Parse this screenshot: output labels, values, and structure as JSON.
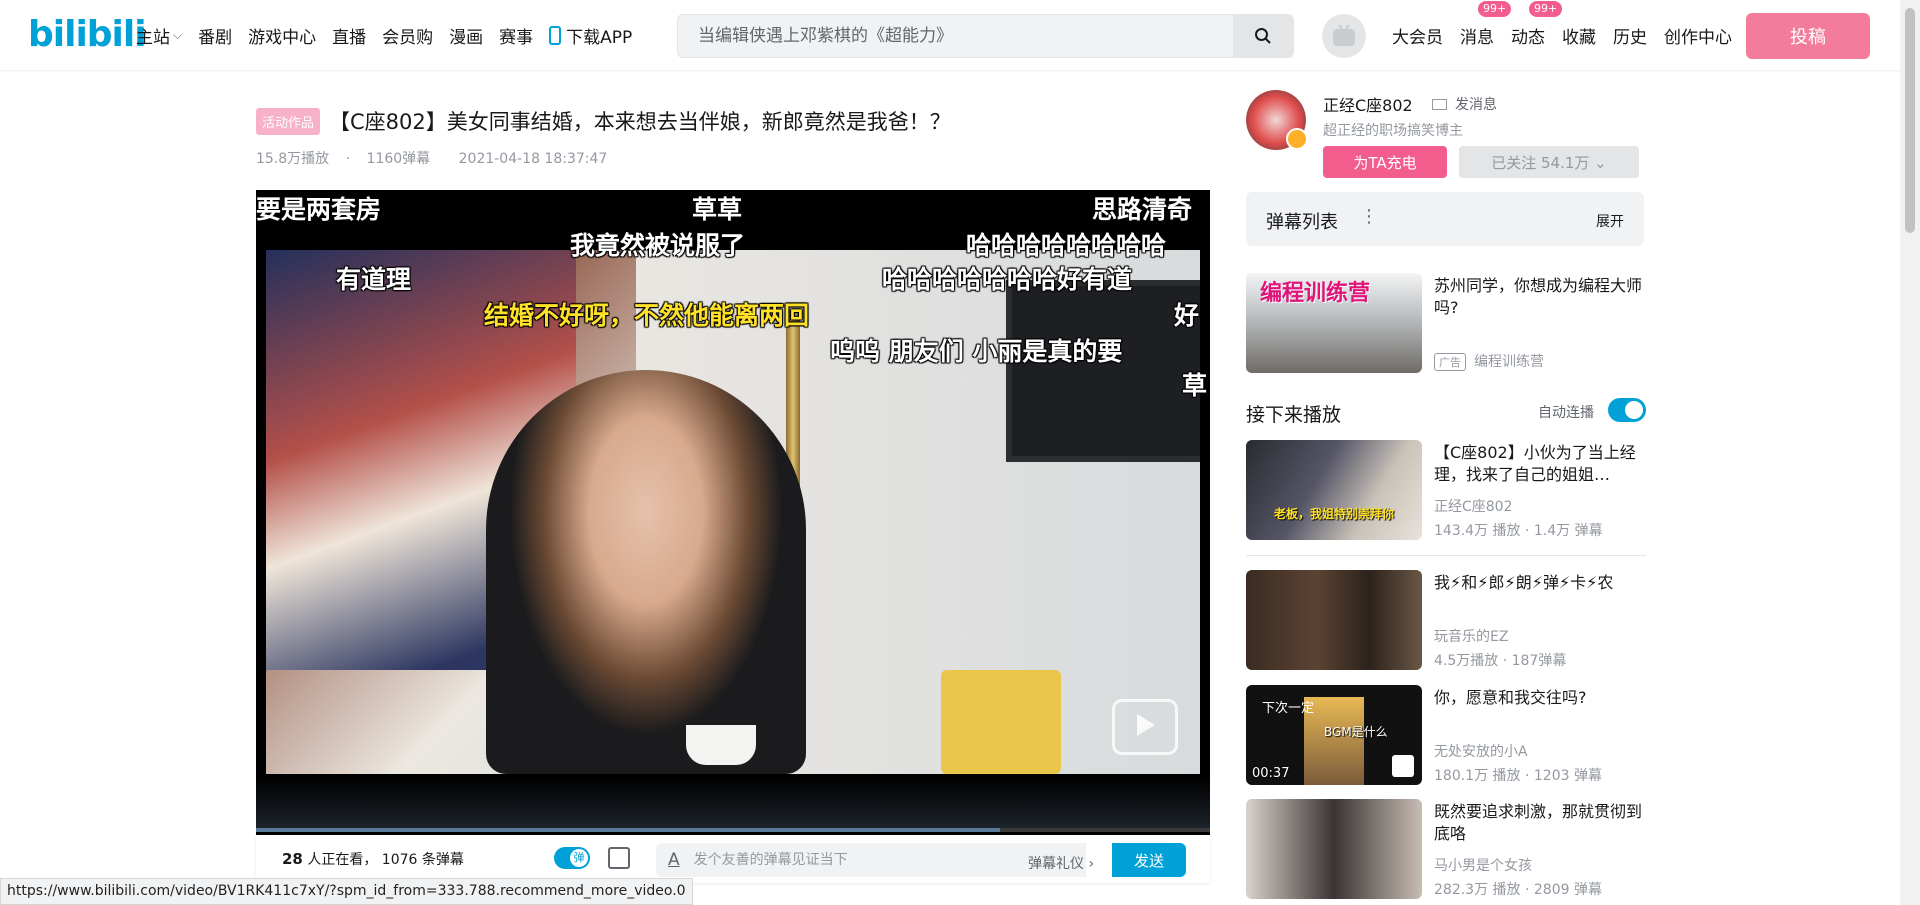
{
  "header": {
    "logo": "bilibili",
    "nav_left": [
      "主站",
      "番剧",
      "游戏中心",
      "直播",
      "会员购",
      "漫画",
      "赛事",
      "下载APP"
    ],
    "search_placeholder": "当编辑侠遇上邓紫棋的《超能力》",
    "nav_right": [
      {
        "label": "大会员",
        "badge": ""
      },
      {
        "label": "消息",
        "badge": "99+"
      },
      {
        "label": "动态",
        "badge": "99+"
      },
      {
        "label": "收藏",
        "badge": ""
      },
      {
        "label": "历史",
        "badge": ""
      },
      {
        "label": "创作中心",
        "badge": ""
      }
    ],
    "upload": "投稿"
  },
  "video": {
    "tag": "活动作品",
    "title": "【C座802】美女同事结婚，本来想去当伴娘，新郎竟然是我爸！？",
    "plays": "15.8万播放",
    "separator": "·",
    "danmaku_count": "1160弹幕",
    "date": "2021-04-18 18:37:47",
    "progress": 0.78
  },
  "danmaku_on_screen": [
    {
      "text": "要是两套房",
      "color": "#ffffff"
    },
    {
      "text": "草草",
      "color": "#ffffff"
    },
    {
      "text": "思路清奇",
      "color": "#ffffff"
    },
    {
      "text": "我竟然被说服了",
      "color": "#ffffff"
    },
    {
      "text": "哈哈哈哈哈哈哈哈",
      "color": "#ffffff"
    },
    {
      "text": "有道理",
      "color": "#ffffff"
    },
    {
      "text": "哈哈哈哈哈哈哈好有道",
      "color": "#ffffff"
    },
    {
      "text": "结婚不好呀，不然他能离两回",
      "color": "#ffe227"
    },
    {
      "text": "好",
      "color": "#ffffff"
    },
    {
      "text": "呜呜  朋友们  小丽是真的要",
      "color": "#ffffff"
    },
    {
      "text": "草",
      "color": "#ffffff"
    }
  ],
  "sendbar": {
    "viewers_num": "28",
    "viewers_text": "人正在看，",
    "dm_total": "1076 条弹幕",
    "input_placeholder": "发个友善的弹幕见证当下",
    "etiquette": "弹幕礼仪 ›",
    "send": "发送"
  },
  "status_url": "https://www.bilibili.com/video/BV1RK411c7xY/?spm_id_from=333.788.recommend_more_video.0",
  "up": {
    "name": "正经C座802",
    "message": "发消息",
    "desc": "超正经的职场搞笑博主",
    "charge": "为TA充电",
    "follow": "已关注 54.1万 ⌄"
  },
  "danmaku_list": {
    "label": "弹幕列表",
    "dots": "⋮",
    "expand": "展开"
  },
  "ad": {
    "thumb_text": "编程训练营",
    "title": "苏州同学，你想成为编程大师吗?",
    "tag": "广告",
    "author": "编程训练营"
  },
  "up_next": {
    "label": "接下来播放",
    "autoplay": "自动连播"
  },
  "recommendations": [
    {
      "title": "【C座802】小伙为了当上经理，找来了自己的姐姐…",
      "author": "正经C座802",
      "stats": "143.4万 播放 · 1.4万 弹幕",
      "thumb_caption": "老板，我姐特别崇拜你",
      "duration": ""
    },
    {
      "title": "我⚡和⚡郎⚡朗⚡弹⚡卡⚡农",
      "author": "玩音乐的EZ",
      "stats": "4.5万播放 · 187弹幕",
      "thumb_caption": "",
      "duration": ""
    },
    {
      "title": "你，愿意和我交往吗?",
      "author": "无处安放的小A",
      "stats": "180.1万 播放 · 1203 弹幕",
      "thumb_caption": "BGM是什么",
      "duration": "00:37",
      "thumb_top": "下次一定"
    },
    {
      "title": "既然要追求刺激，那就贯彻到底咯",
      "author": "马小男是个女孩",
      "stats": "282.3万 播放 · 2809 弹幕",
      "thumb_caption": "",
      "duration": ""
    }
  ]
}
